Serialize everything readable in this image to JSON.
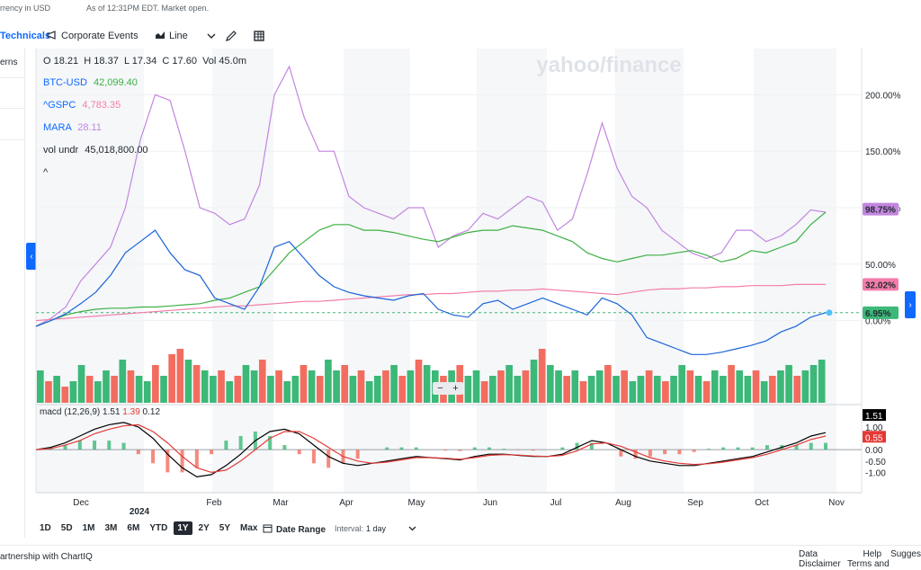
{
  "header": {
    "currency_note": "rrency in USD",
    "as_of": "As of 12:31PM EDT. Market open."
  },
  "toolbar": {
    "technicals": "Technicals",
    "corporate_events": "Corporate Events",
    "chart_type": "Line"
  },
  "left_panel": {
    "label": "erns"
  },
  "watermark": "yahoo/finance",
  "legend": {
    "ohlc": {
      "o_label": "O",
      "o": "18.21",
      "h_label": "H",
      "h": "18.37",
      "l_label": "L",
      "l": "17.34",
      "c_label": "C",
      "c": "17.60",
      "vol_label": "Vol",
      "vol": "45.0m"
    },
    "series": [
      {
        "name": "BTC-USD",
        "value": "42,099.40",
        "color": "#3cb043"
      },
      {
        "name": "^GSPC",
        "value": "4,783.35",
        "color": "#f47dab"
      },
      {
        "name": "MARA",
        "value": "28.11",
        "color": "#c386df"
      }
    ],
    "vol_undr_label": "vol undr",
    "vol_undr": "45,018,800.00",
    "collapse": "^"
  },
  "right_badges": {
    "mara": "98.75%",
    "gspc": "32.02%",
    "main": "6.95%",
    "macd_top": "1.51",
    "macd_val": "0.55"
  },
  "macd_legend": {
    "label": "macd (12,26,9)",
    "v1": "1.51",
    "v2": "1.39",
    "v3": "0.12"
  },
  "ranges": [
    "1D",
    "5D",
    "1M",
    "3M",
    "6M",
    "YTD",
    "1Y",
    "2Y",
    "5Y",
    "Max"
  ],
  "active_range": "1Y",
  "date_range": "Date Range",
  "interval_label": "Interval:",
  "interval_value": "1 day",
  "footer": {
    "partner": "artnership with ChartIQ",
    "links": [
      "Data Disclaimer",
      "Help",
      "Sugges"
    ],
    "terms": "Terms and Privacy F"
  },
  "colors": {
    "accent": "#0f69ff",
    "up": "#3cb878",
    "down": "#f26d5f",
    "macd": "#000000",
    "signal": "#e53935"
  },
  "chart_data": [
    {
      "type": "line",
      "title": "",
      "x_ticks": [
        "Dec",
        "2024",
        "Feb",
        "Mar",
        "Apr",
        "May",
        "Jun",
        "Jul",
        "Aug",
        "Sep",
        "Oct",
        "Nov"
      ],
      "y_ticks": [
        "200.00%",
        "150.00%",
        "100.00%",
        "50.00%",
        "0.00%"
      ],
      "ylim": [
        -25,
        225
      ],
      "series": [
        {
          "name": "MARA",
          "color": "#c386df",
          "values": [
            -5,
            2,
            12,
            35,
            50,
            65,
            100,
            160,
            200,
            195,
            150,
            100,
            95,
            85,
            90,
            120,
            200,
            225,
            180,
            150,
            150,
            110,
            100,
            95,
            90,
            100,
            100,
            65,
            75,
            80,
            95,
            90,
            100,
            110,
            105,
            80,
            90,
            130,
            175,
            135,
            110,
            100,
            80,
            70,
            60,
            55,
            60,
            80,
            80,
            70,
            75,
            85,
            98,
            96
          ]
        },
        {
          "name": "BTC-USD",
          "color": "#3cb043",
          "values": [
            -5,
            0,
            5,
            8,
            10,
            11,
            11,
            12,
            12,
            13,
            14,
            15,
            18,
            20,
            25,
            30,
            45,
            60,
            70,
            80,
            85,
            85,
            80,
            80,
            78,
            75,
            72,
            70,
            74,
            78,
            80,
            80,
            84,
            82,
            80,
            75,
            70,
            60,
            55,
            52,
            55,
            58,
            58,
            60,
            62,
            58,
            52,
            55,
            62,
            60,
            65,
            70,
            85,
            96
          ]
        },
        {
          "name": "^GSPC",
          "color": "#f47dab",
          "values": [
            0,
            1,
            2,
            3,
            4,
            5,
            6,
            7,
            8,
            9,
            10,
            11,
            12,
            13,
            13,
            14,
            15,
            16,
            17,
            17,
            18,
            19,
            20,
            21,
            22,
            23,
            23,
            24,
            24,
            25,
            26,
            26,
            27,
            27,
            28,
            27,
            26,
            25,
            24,
            23,
            25,
            27,
            28,
            28,
            29,
            29,
            30,
            30,
            31,
            31,
            31,
            32,
            32,
            32
          ]
        },
        {
          "name": "MARA (main)",
          "color": "#1a63d8",
          "values": [
            -5,
            0,
            6,
            15,
            25,
            40,
            60,
            70,
            80,
            60,
            45,
            40,
            20,
            15,
            10,
            30,
            65,
            70,
            55,
            40,
            30,
            25,
            22,
            20,
            18,
            22,
            24,
            10,
            5,
            3,
            15,
            18,
            10,
            15,
            20,
            15,
            10,
            5,
            20,
            15,
            5,
            -15,
            -20,
            -25,
            -30,
            -30,
            -28,
            -25,
            -22,
            -18,
            -10,
            -5,
            3,
            7
          ]
        }
      ]
    },
    {
      "type": "bar",
      "title": "vol undr",
      "values": [
        6,
        4,
        5,
        3,
        4,
        7,
        5,
        4,
        6,
        5,
        8,
        6,
        5,
        4,
        7,
        5,
        9,
        10,
        8,
        7,
        6,
        5,
        6,
        4,
        5,
        7,
        6,
        8,
        5,
        6,
        4,
        5,
        7,
        6,
        5,
        8,
        6,
        7,
        5,
        6,
        4,
        5,
        6,
        7,
        5,
        6,
        8,
        7,
        6,
        5,
        6,
        7,
        5,
        6,
        4,
        5,
        6,
        7,
        5,
        6,
        8,
        10,
        7,
        6,
        5,
        6,
        4,
        5,
        6,
        7,
        5,
        6,
        4,
        5,
        6,
        5,
        4,
        5,
        7,
        6,
        5,
        4,
        6,
        5,
        7,
        6,
        5,
        6,
        4,
        5,
        6,
        7,
        5,
        6,
        7,
        8
      ],
      "up": [
        1,
        0,
        1,
        0,
        1,
        1,
        0,
        1,
        1,
        0,
        1,
        0,
        1,
        1,
        0,
        1,
        0,
        0,
        1,
        0,
        1,
        1,
        0,
        1,
        0,
        1,
        1,
        0,
        1,
        0,
        1,
        1,
        0,
        1,
        0,
        1,
        1,
        0,
        1,
        0,
        1,
        1,
        0,
        1,
        0,
        1,
        0,
        1,
        1,
        0,
        1,
        0,
        1,
        1,
        0,
        1,
        0,
        1,
        1,
        0,
        1,
        0,
        1,
        1,
        0,
        1,
        0,
        1,
        1,
        0,
        1,
        0,
        1,
        1,
        0,
        1,
        0,
        1,
        1,
        0,
        1,
        0,
        1,
        1,
        0,
        1,
        1,
        0,
        1,
        0,
        1,
        1,
        0,
        1,
        1,
        1
      ]
    },
    {
      "type": "line",
      "title": "macd (12,26,9)",
      "y_ticks": [
        "1.50",
        "1.00",
        "0.50",
        "0.00",
        "-0.50",
        "-1.00"
      ],
      "ylim": [
        -1.5,
        1.75
      ],
      "series": [
        {
          "name": "macd",
          "color": "#000000",
          "values": [
            0,
            0.1,
            0.3,
            0.6,
            0.9,
            1.1,
            1.2,
            1.0,
            0.5,
            -0.2,
            -0.8,
            -1.2,
            -1.1,
            -0.7,
            -0.2,
            0.4,
            0.8,
            0.9,
            0.7,
            0.2,
            -0.3,
            -0.6,
            -0.7,
            -0.6,
            -0.5,
            -0.4,
            -0.3,
            -0.35,
            -0.4,
            -0.45,
            -0.3,
            -0.2,
            -0.2,
            -0.25,
            -0.3,
            -0.3,
            -0.2,
            0.1,
            0.4,
            0.3,
            0.0,
            -0.3,
            -0.5,
            -0.6,
            -0.7,
            -0.7,
            -0.6,
            -0.5,
            -0.4,
            -0.3,
            -0.1,
            0.1,
            0.3,
            0.6,
            0.75
          ]
        },
        {
          "name": "signal",
          "color": "#e53935",
          "values": [
            0,
            0.05,
            0.2,
            0.4,
            0.7,
            0.9,
            1.05,
            1.1,
            0.8,
            0.3,
            -0.3,
            -0.8,
            -1.0,
            -0.9,
            -0.5,
            0.0,
            0.5,
            0.8,
            0.8,
            0.5,
            0.1,
            -0.3,
            -0.5,
            -0.6,
            -0.55,
            -0.45,
            -0.35,
            -0.35,
            -0.38,
            -0.42,
            -0.35,
            -0.25,
            -0.22,
            -0.24,
            -0.28,
            -0.3,
            -0.25,
            -0.05,
            0.25,
            0.3,
            0.15,
            -0.1,
            -0.35,
            -0.5,
            -0.6,
            -0.65,
            -0.62,
            -0.55,
            -0.45,
            -0.35,
            -0.2,
            0.0,
            0.2,
            0.45,
            0.6
          ]
        }
      ]
    }
  ]
}
